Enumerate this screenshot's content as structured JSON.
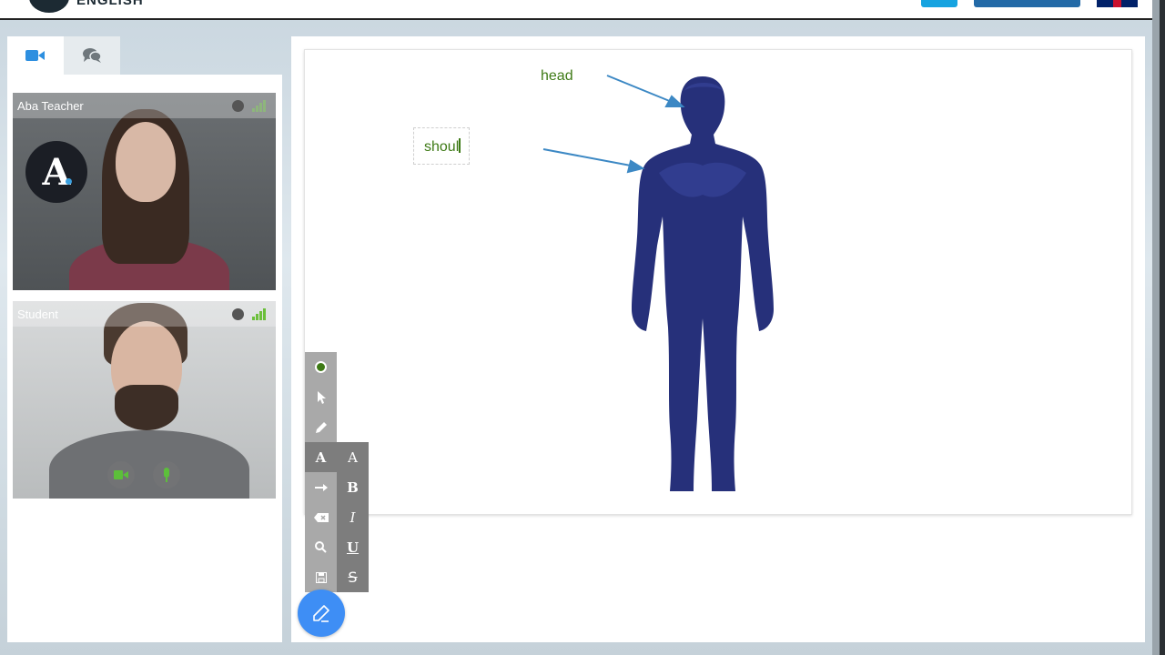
{
  "header": {
    "brand_text": "ENGLISH",
    "flag_icon": "uk-flag-icon"
  },
  "tabs": [
    {
      "name": "video",
      "icon": "video-camera-icon",
      "active": true
    },
    {
      "name": "chat",
      "icon": "chat-bubbles-icon",
      "active": false
    }
  ],
  "participants": {
    "teacher": {
      "name": "Aba Teacher",
      "badge": "A"
    },
    "student": {
      "name": "Student"
    }
  },
  "whiteboard": {
    "label_head": "head",
    "textbox_text": "shoul",
    "figure": "human-body-silhouette",
    "arrow_color": "#3c88c4",
    "text_color": "#3e7a16",
    "figure_color": "#26307a"
  },
  "toolbar": {
    "current_color": "#3e7a16",
    "tools": [
      "color",
      "select",
      "pencil",
      "text",
      "arrow",
      "eraser",
      "zoom",
      "save"
    ],
    "text_tools": [
      "font-size",
      "bold",
      "italic",
      "underline",
      "strikethrough"
    ],
    "font_size_label": "A",
    "text_label": "A",
    "bold_label": "B",
    "italic_label": "I",
    "underline_label": "U",
    "strike_label": "S"
  },
  "colors": {
    "accent_blue": "#3e8ef5",
    "signal_green": "#6bbf3a"
  }
}
